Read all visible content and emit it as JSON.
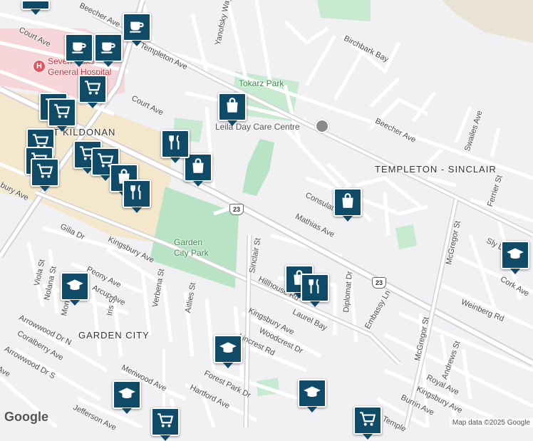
{
  "map": {
    "attribution": "Map data ©2025 Google",
    "logo": "Google",
    "areas": [
      {
        "name": "TEMPLETON - SINCLAIR"
      },
      {
        "name": "GARDEN CITY"
      },
      {
        "name": "ST KILDONAN"
      }
    ],
    "parks": [
      {
        "name": "Tokarz Park"
      },
      {
        "name": "Garden City Park",
        "line1": "Garden",
        "line2": "City Park"
      }
    ],
    "places": {
      "hospital_line1": "Seven Oaks",
      "hospital_line2": "General Hospital",
      "daycare": "Leila Day Care Centre"
    },
    "route_shield": "23",
    "streets": {
      "court_ave_1": "Court Ave",
      "court_ave_2": "Court Ave",
      "templeton": "Templeton Ave",
      "beecher_1": "Beecher Ave",
      "beecher_2": "Beecher Ave",
      "yanofsky": "Yanofsky Way",
      "birchbark": "Birchbark Bay",
      "swailes": "Swailes Ave",
      "ferrier": "Ferrier St",
      "consulate": "Consulate Rd",
      "mathias": "Mathias Ave",
      "mcgregor_1": "McGregor St",
      "mcgregor_2": "McGregor St",
      "sly": "Sly Dr",
      "cork": "Cork Ave",
      "weinberg": "Weinberg Rd",
      "embassy": "Embassy Ln",
      "diplomat": "Diplomat Dr",
      "sinclair": "Sinclair St",
      "hillhouse": "Hillhouse Rd",
      "laurel": "Laurel Bay",
      "kingsbury_1": "Kingsbury Ave",
      "kingsbury_2": "Kingsbury Ave",
      "woodcrest": "Woodcrest Dr",
      "lincrest": "Lincrest Rd",
      "gilia": "Gilia Dr",
      "peony": "Peony Ave",
      "arcup": "Arcup Ave",
      "viola": "Viola St",
      "nolana": "Nolana St",
      "morris": "Morris",
      "iris": "Iris St",
      "verbena": "Verbena St",
      "aitlies": "Aitlies St",
      "arrowwood_n": "Arrowwood Dr N",
      "coralberry": "Coralberry Ave",
      "arrowwood_s": "Arrowwood Dr S",
      "meriwood": "Meriwood Ave",
      "forest_park": "Forest Park Dr",
      "hartford": "Hartford Ave",
      "jefferson": "Jefferson Ave",
      "royal": "Royal Ave",
      "andrews": "Andrews St",
      "kingsbury_3": "Kingsbury Ave",
      "burrin": "Burrin Ave",
      "templeton_s": "Temple",
      "ave_left": "Ave",
      "bury_ave": "bury Ave"
    },
    "icons": {
      "cafe": "coffee-cup",
      "shop": "shopping-bag",
      "grocery": "shopping-cart",
      "food": "fork-knife",
      "school": "graduation-cap",
      "hospital": "hospital-h",
      "daycare": "location-pin"
    },
    "colors": {
      "background": "#f1f0f3",
      "road": "#ffffff",
      "arterial": "#d9d8dc",
      "park": "#b9e3c5",
      "hospital_area": "#f6d6d8",
      "commercial": "#f3e7cc",
      "marker": "#0f4a67",
      "water": "#e8e3d5"
    }
  }
}
